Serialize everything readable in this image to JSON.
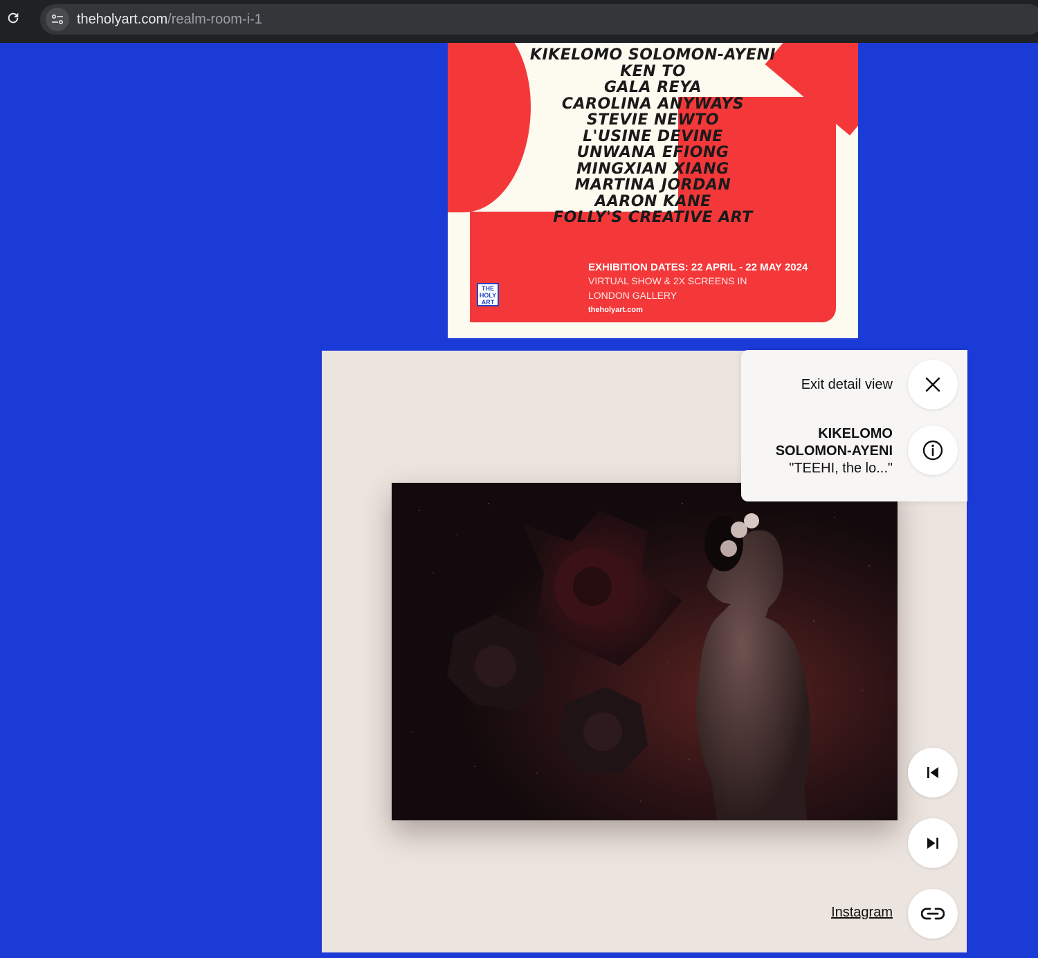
{
  "browser": {
    "url_domain": "theholyart.com",
    "url_path": "/realm-room-i-1"
  },
  "poster": {
    "artists": [
      "KIKELOMO SOLOMON-AYENI",
      "KEN TO",
      "GALA REYA",
      "CAROLINA ANYWAYS",
      "STEVIE NEWTO",
      "L'USINE DEVINE",
      "UNWANA EFIONG",
      "MINGXIAN XIANG",
      "MARTINA JORDAN",
      "AARON KANE",
      "FOLLY'S CREATIVE ART"
    ],
    "exhibition_dates": "EXHIBITION DATES: 22 APRIL - 22 MAY 2024",
    "show_line1": "VIRTUAL SHOW & 2X SCREENS IN",
    "show_line2": "LONDON GALLERY",
    "website": "theholyart.com",
    "logo_lines": [
      "THE",
      "HOLY",
      "ART"
    ]
  },
  "detail": {
    "exit_label": "Exit detail view",
    "artist_line1": "KIKELOMO",
    "artist_line2": "SOLOMON-AYENI",
    "title": "\"TEEHI, the lo...\"",
    "instagram_label": "Instagram"
  },
  "colors": {
    "background": "#1a3bd6",
    "poster_red": "#f4383a",
    "panel": "#ece4df"
  }
}
